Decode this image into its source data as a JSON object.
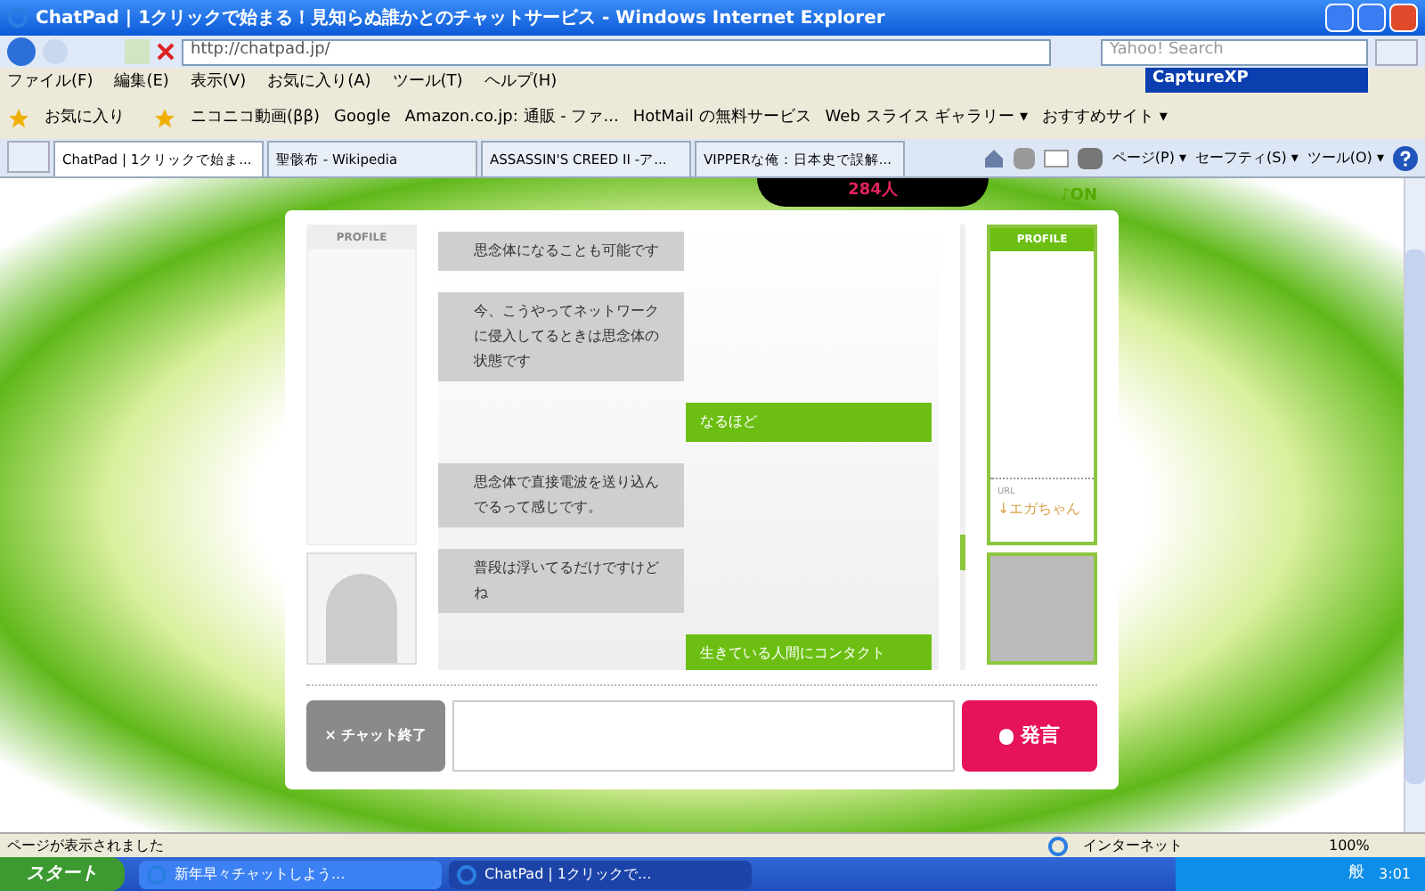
{
  "window": {
    "title": "ChatPad | 1クリックで始まる！見知らぬ誰かとのチャットサービス - Windows Internet Explorer"
  },
  "address": {
    "value": "http://chatpad.jp/"
  },
  "search": {
    "placeholder": "Yahoo! Search"
  },
  "overlay_window": {
    "title": "CaptureXP"
  },
  "menu": [
    "ファイル(F)",
    "編集(E)",
    "表示(V)",
    "お気に入り(A)",
    "ツール(T)",
    "ヘルプ(H)"
  ],
  "favorites": {
    "label": "お気に入り",
    "items": [
      "ニコニコ動画(ββ)",
      "Google",
      "Amazon.co.jp: 通販 - ファ...",
      "HotMail の無料サービス",
      "Web スライス ギャラリー ▾",
      "おすすめサイト ▾"
    ]
  },
  "tabs": [
    {
      "label": "ChatPad | 1クリックで始ま...",
      "selected": true
    },
    {
      "label": "聖骸布 - Wikipedia",
      "selected": false
    },
    {
      "label": "ASSASSIN'S CREED II -ア...",
      "selected": false
    },
    {
      "label": "VIPPERな俺：日本史で誤解...",
      "selected": false
    }
  ],
  "command_bar": [
    "ページ(P) ▾",
    "セーフティ(S) ▾",
    "ツール(O) ▾"
  ],
  "page": {
    "counter": "284人",
    "sound": "♪ON",
    "left_profile": {
      "header": "PROFILE"
    },
    "right_profile": {
      "header": "PROFILE",
      "url_label": "URL",
      "url_value": "↓エガちゃん"
    },
    "messages": [
      {
        "kind": "them",
        "text": "思念体になることも可能です"
      },
      {
        "kind": "them",
        "text": "今、こうやってネットワークに侵入してるときは思念体の状態です"
      },
      {
        "kind": "me",
        "text": "なるほど"
      },
      {
        "kind": "them",
        "text": "思念体で直接電波を送り込んでるって感じです。"
      },
      {
        "kind": "them",
        "text": "普段は浮いてるだけですけどね"
      },
      {
        "kind": "me",
        "text": "生きている人間にコンタクト"
      }
    ],
    "end_button": "× チャット終了",
    "say_button": "発言"
  },
  "status_bar": {
    "text": "ページが表示されました",
    "zone": "インターネット",
    "zoom": "100%"
  },
  "taskbar": {
    "start": "スタート",
    "tasks": [
      {
        "label": "新年早々チャットしよう...",
        "selected": false
      },
      {
        "label": "ChatPad | 1クリックで...",
        "selected": true
      }
    ],
    "ime": "般",
    "clock": "3:01"
  }
}
